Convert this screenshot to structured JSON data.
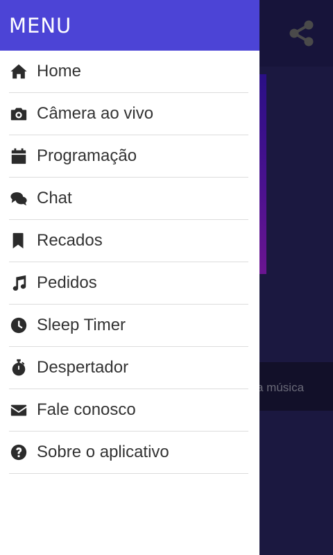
{
  "drawer": {
    "title": "MENU",
    "items": [
      {
        "label": "Home",
        "icon": "home-icon"
      },
      {
        "label": "Câmera ao vivo",
        "icon": "camera-icon"
      },
      {
        "label": "Programação",
        "icon": "calendar-icon"
      },
      {
        "label": "Chat",
        "icon": "chat-icon"
      },
      {
        "label": "Recados",
        "icon": "bookmark-icon"
      },
      {
        "label": "Pedidos",
        "icon": "music-note-icon"
      },
      {
        "label": "Sleep Timer",
        "icon": "clock-icon"
      },
      {
        "label": "Despertador",
        "icon": "stopwatch-icon"
      },
      {
        "label": "Fale conosco",
        "icon": "envelope-icon"
      },
      {
        "label": "Sobre o aplicativo",
        "icon": "question-circle-icon"
      }
    ]
  },
  "background": {
    "now_playing_text": "a música",
    "share_icon": "share-icon"
  },
  "colors": {
    "drawer_header": "#4c44d6",
    "app_background": "#1b1840",
    "text": "#333333",
    "divider": "#dcdcdc"
  }
}
